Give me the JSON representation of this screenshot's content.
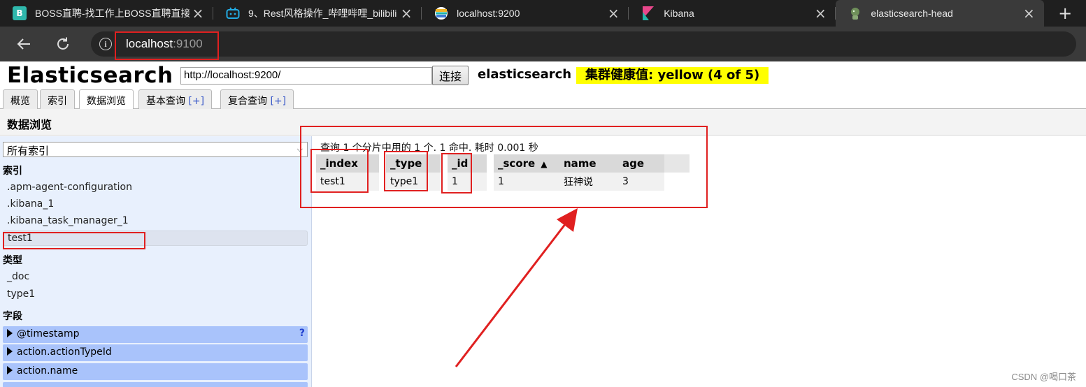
{
  "browser": {
    "tabs": [
      {
        "title": "BOSS直聘-找工作上BOSS直聘直接",
        "icon": "boss-zhipin-icon",
        "favicon_text": "B",
        "favicon_color": "#2fb8ac"
      },
      {
        "title": "9、Rest风格操作_哔哩哔哩_bilibili",
        "icon": "bilibili-icon",
        "favicon_text": "📺",
        "favicon_color": "#23ade5"
      },
      {
        "title": "localhost:9200",
        "icon": "elasticsearch-icon",
        "favicon_text": "",
        "favicon_color": "#f0b429"
      },
      {
        "title": "Kibana",
        "icon": "kibana-icon",
        "favicon_text": "",
        "favicon_color": "#e8478b"
      },
      {
        "title": "elasticsearch-head",
        "icon": "elasticsearch-head-icon",
        "favicon_text": "",
        "favicon_color": "#6f8f5a"
      }
    ],
    "active_tab_index": 4,
    "new_tab": "+",
    "address": {
      "host": "localhost",
      "port": ":9100"
    }
  },
  "app": {
    "logo": "Elasticsearch",
    "cluster_url": "http://localhost:9200/",
    "connect_label": "连接",
    "cluster_name": "elasticsearch",
    "health": "集群健康值: yellow (4 of 5)",
    "health_color": "#ffff00"
  },
  "page_tabs": [
    {
      "label": "概览",
      "plus": ""
    },
    {
      "label": "索引",
      "plus": ""
    },
    {
      "label": "数据浏览",
      "plus": ""
    },
    {
      "label": "基本查询 ",
      "plus": "[+]"
    },
    {
      "label": "复合查询 ",
      "plus": "[+]"
    }
  ],
  "active_page_tab": 2,
  "section_title": "数据浏览",
  "sidebar": {
    "index_select": "所有索引",
    "indices_heading": "索引",
    "indices": [
      ".apm-agent-configuration",
      ".kibana_1",
      ".kibana_task_manager_1",
      "test1"
    ],
    "selected_index": "test1",
    "types_heading": "类型",
    "types": [
      "_doc",
      "type1"
    ],
    "fields_heading": "字段",
    "fields": [
      "@timestamp",
      "action.actionTypeId",
      "action.name"
    ],
    "help_mark": "?"
  },
  "results": {
    "summary": "查询 1 个分片中用的 1 个. 1 命中. 耗时 0.001 秒",
    "columns": [
      "_index",
      "_type",
      "_id",
      "_score",
      "name",
      "age"
    ],
    "sort_column": "_score",
    "sort_mark": "▲",
    "rows": [
      [
        "test1",
        "type1",
        "1",
        "1",
        "狂神说",
        "3"
      ]
    ]
  },
  "annotation_color": "#e02020",
  "watermark": "CSDN @喝口茶"
}
